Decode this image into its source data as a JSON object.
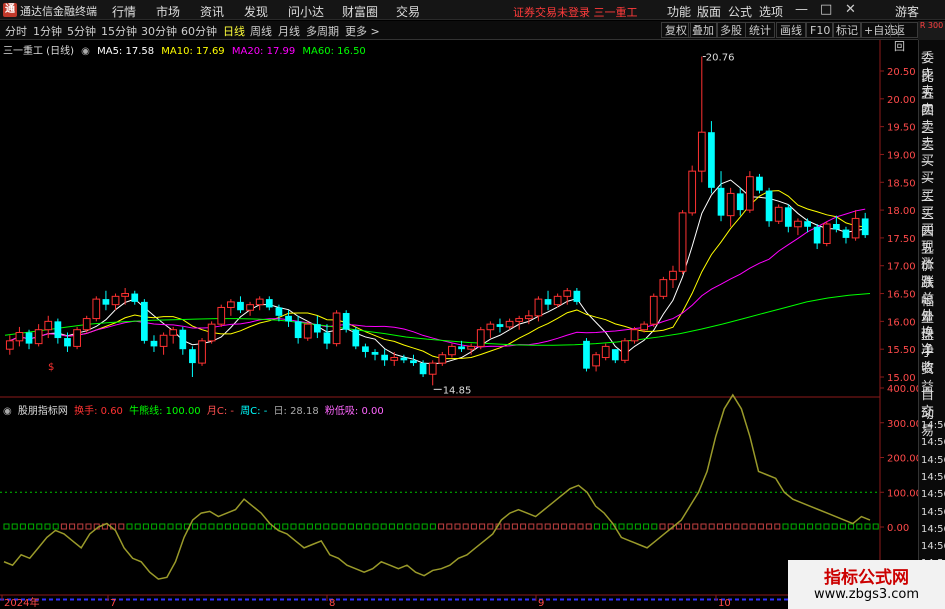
{
  "app": {
    "title": "通达信金融终端",
    "logo_char": "通",
    "menus": [
      "行情",
      "市场",
      "资讯",
      "发现",
      "问小达",
      "财富圈",
      "交易"
    ],
    "trade_warning": "证券交易未登录  三一重工",
    "right_menus": [
      "功能",
      "版面",
      "公式",
      "选项"
    ],
    "user": "游客",
    "window_controls": [
      "—",
      "□",
      "✕"
    ]
  },
  "toolbar": {
    "periods": [
      "分时",
      "1分钟",
      "5分钟",
      "15分钟",
      "30分钟",
      "60分钟",
      "日线",
      "周线",
      "月线",
      "多周期",
      "更多 >"
    ],
    "active_period": "日线",
    "buttons": [
      "复权",
      "叠加",
      "多股",
      "统计",
      "画线",
      "F10",
      "标记",
      "+自选",
      "返回"
    ],
    "sidebar_head": "R 300"
  },
  "price_header": {
    "stock": "三一重工 (日线)",
    "ma5": "MA5: 17.58",
    "ma10": "MA10: 17.69",
    "ma20": "MA20: 17.99",
    "ma60": "MA60: 16.50"
  },
  "price_axis": [
    "20.50",
    "20.00",
    "19.50",
    "19.00",
    "18.50",
    "18.00",
    "17.50",
    "17.00",
    "16.50",
    "16.00",
    "15.50",
    "15.00"
  ],
  "price_annotations": {
    "high": "20.76",
    "low": "14.85"
  },
  "indicator_header": {
    "name": "股朋指标网",
    "turnover": "换手: 0.60",
    "bull_bear": "牛熊线: 100.00",
    "month": "月C: -",
    "week": "周C: -",
    "day": "日: 28.18",
    "low_zone": "粉低吸: 0.00"
  },
  "indicator_axis": [
    "400.00",
    "300.00",
    "200.00",
    "100.00",
    "0.00"
  ],
  "date_axis": [
    "2024年",
    "7",
    "8",
    "9",
    "10"
  ],
  "right_panel": [
    "委比",
    "卖五",
    "卖四",
    "卖三",
    "卖二",
    "卖一",
    "买一",
    "买二",
    "买三",
    "买四",
    "买五",
    "现价",
    "涨跌",
    "涨幅",
    "总量",
    "外盘",
    "换手",
    "净资",
    "收益",
    "自动",
    "交易",
    "14:56",
    "14:56",
    "14:56",
    "14:56",
    "14:56",
    "14:56",
    "14:56",
    "14:56",
    "14:56"
  ],
  "watermark": {
    "title": "指标公式网",
    "url": "www.zbgs3.com"
  },
  "colors": {
    "up": "#ff3232",
    "down": "#00ffff",
    "ma5": "#ffffff",
    "ma10": "#ffff00",
    "ma20": "#ff00ff",
    "ma60": "#00ff00",
    "indicator": "#9a9a2a"
  },
  "chart_data": [
    {
      "type": "candlestick",
      "title": "三一重工 (日线)",
      "ylim": [
        14.7,
        20.8
      ],
      "x_months": [
        "2024年",
        "7",
        "8",
        "9",
        "10"
      ],
      "ohlc": [
        [
          15.5,
          15.75,
          15.4,
          15.65
        ],
        [
          15.65,
          15.9,
          15.55,
          15.8
        ],
        [
          15.8,
          15.85,
          15.5,
          15.6
        ],
        [
          15.6,
          15.95,
          15.55,
          15.85
        ],
        [
          15.85,
          16.1,
          15.7,
          16.0
        ],
        [
          16.0,
          16.05,
          15.6,
          15.7
        ],
        [
          15.7,
          15.8,
          15.45,
          15.55
        ],
        [
          15.55,
          15.9,
          15.5,
          15.85
        ],
        [
          15.85,
          16.1,
          15.8,
          16.05
        ],
        [
          16.05,
          16.45,
          16.0,
          16.4
        ],
        [
          16.4,
          16.55,
          16.2,
          16.3
        ],
        [
          16.3,
          16.5,
          16.2,
          16.45
        ],
        [
          16.45,
          16.6,
          16.3,
          16.5
        ],
        [
          16.5,
          16.55,
          16.3,
          16.35
        ],
        [
          16.35,
          16.4,
          15.6,
          15.65
        ],
        [
          15.65,
          15.75,
          15.45,
          15.55
        ],
        [
          15.55,
          15.8,
          15.4,
          15.75
        ],
        [
          15.75,
          15.9,
          15.6,
          15.85
        ],
        [
          15.85,
          15.9,
          15.4,
          15.5
        ],
        [
          15.5,
          15.55,
          15.0,
          15.25
        ],
        [
          15.25,
          15.7,
          15.2,
          15.65
        ],
        [
          15.65,
          16.0,
          15.6,
          15.95
        ],
        [
          15.95,
          16.3,
          15.9,
          16.25
        ],
        [
          16.25,
          16.4,
          16.1,
          16.35
        ],
        [
          16.35,
          16.45,
          16.15,
          16.2
        ],
        [
          16.2,
          16.35,
          16.1,
          16.3
        ],
        [
          16.3,
          16.45,
          16.2,
          16.4
        ],
        [
          16.4,
          16.45,
          16.2,
          16.25
        ],
        [
          16.25,
          16.3,
          16.0,
          16.1
        ],
        [
          16.1,
          16.2,
          15.9,
          16.0
        ],
        [
          16.0,
          16.1,
          15.6,
          15.7
        ],
        [
          15.7,
          16.0,
          15.65,
          15.95
        ],
        [
          15.95,
          16.1,
          15.7,
          15.8
        ],
        [
          15.8,
          15.95,
          15.5,
          15.6
        ],
        [
          15.6,
          16.2,
          15.55,
          16.15
        ],
        [
          16.15,
          16.2,
          15.8,
          15.85
        ],
        [
          15.85,
          15.9,
          15.5,
          15.55
        ],
        [
          15.55,
          15.6,
          15.35,
          15.45
        ],
        [
          15.45,
          15.5,
          15.3,
          15.4
        ],
        [
          15.4,
          15.5,
          15.2,
          15.3
        ],
        [
          15.3,
          15.45,
          15.2,
          15.35
        ],
        [
          15.35,
          15.4,
          15.25,
          15.3
        ],
        [
          15.3,
          15.4,
          15.2,
          15.25
        ],
        [
          15.25,
          15.3,
          15.0,
          15.05
        ],
        [
          15.05,
          15.3,
          14.85,
          15.25
        ],
        [
          15.25,
          15.45,
          15.2,
          15.4
        ],
        [
          15.4,
          15.6,
          15.35,
          15.55
        ],
        [
          15.55,
          15.65,
          15.45,
          15.5
        ],
        [
          15.5,
          15.6,
          15.4,
          15.55
        ],
        [
          15.55,
          15.9,
          15.5,
          15.85
        ],
        [
          15.85,
          16.0,
          15.7,
          15.95
        ],
        [
          15.95,
          16.05,
          15.8,
          15.9
        ],
        [
          15.9,
          16.05,
          15.85,
          16.0
        ],
        [
          16.0,
          16.1,
          15.85,
          16.05
        ],
        [
          16.05,
          16.2,
          15.95,
          16.1
        ],
        [
          16.1,
          16.45,
          16.0,
          16.4
        ],
        [
          16.4,
          16.55,
          16.2,
          16.3
        ],
        [
          16.3,
          16.5,
          16.25,
          16.45
        ],
        [
          16.45,
          16.6,
          16.3,
          16.55
        ],
        [
          16.55,
          16.6,
          16.3,
          16.35
        ],
        [
          15.65,
          15.7,
          15.1,
          15.15
        ],
        [
          15.2,
          15.45,
          15.1,
          15.4
        ],
        [
          15.35,
          15.6,
          15.3,
          15.55
        ],
        [
          15.5,
          15.5,
          15.25,
          15.3
        ],
        [
          15.3,
          15.7,
          15.25,
          15.65
        ],
        [
          15.65,
          15.9,
          15.6,
          15.85
        ],
        [
          15.85,
          16.0,
          15.8,
          15.95
        ],
        [
          15.95,
          16.5,
          15.9,
          16.45
        ],
        [
          16.45,
          16.8,
          16.4,
          16.75
        ],
        [
          16.75,
          17.0,
          16.6,
          16.9
        ],
        [
          16.9,
          18.0,
          16.85,
          17.95
        ],
        [
          17.95,
          18.8,
          17.9,
          18.7
        ],
        [
          18.7,
          20.76,
          18.5,
          19.4
        ],
        [
          19.4,
          19.6,
          18.3,
          18.4
        ],
        [
          18.4,
          18.7,
          17.8,
          17.9
        ],
        [
          17.9,
          18.4,
          17.7,
          18.3
        ],
        [
          18.3,
          18.4,
          17.9,
          18.0
        ],
        [
          18.0,
          18.7,
          17.95,
          18.6
        ],
        [
          18.6,
          18.65,
          18.3,
          18.35
        ],
        [
          18.35,
          18.4,
          17.7,
          17.8
        ],
        [
          17.8,
          18.1,
          17.75,
          18.05
        ],
        [
          18.05,
          18.1,
          17.6,
          17.7
        ],
        [
          17.7,
          17.85,
          17.55,
          17.8
        ],
        [
          17.8,
          17.85,
          17.6,
          17.7
        ],
        [
          17.7,
          17.75,
          17.3,
          17.4
        ],
        [
          17.4,
          17.8,
          17.35,
          17.75
        ],
        [
          17.75,
          17.9,
          17.6,
          17.65
        ],
        [
          17.65,
          17.7,
          17.4,
          17.5
        ],
        [
          17.5,
          18.0,
          17.45,
          17.85
        ],
        [
          17.85,
          17.95,
          17.5,
          17.55
        ]
      ],
      "ma60_line": [
        15.75,
        15.8,
        15.85,
        15.9,
        15.95,
        15.98,
        16.0,
        16.02,
        16.03,
        16.04,
        16.05,
        16.05,
        16.04,
        16.02,
        15.98,
        15.93,
        15.88,
        15.83,
        15.78,
        15.72,
        15.68,
        15.65,
        15.62,
        15.6,
        15.58,
        15.57,
        15.57,
        15.58,
        15.6,
        15.63,
        15.67,
        15.72,
        15.78,
        15.86,
        15.95,
        16.05,
        16.15,
        16.25,
        16.35,
        16.42,
        16.47,
        16.5
      ]
    },
    {
      "type": "line",
      "title": "股朋指标网",
      "ylim": [
        -200,
        420
      ],
      "series": [
        {
          "values": [
            -100,
            -110,
            -80,
            -90,
            -60,
            -30,
            -10,
            -20,
            -40,
            -60,
            -20,
            0,
            10,
            -10,
            -60,
            -90,
            -100,
            -130,
            -150,
            -145,
            -100,
            -30,
            20,
            40,
            45,
            30,
            40,
            50,
            80,
            60,
            40,
            10,
            -10,
            -20,
            -40,
            -60,
            -50,
            -40,
            -80,
            -90,
            -110,
            -120,
            -130,
            -120,
            -100,
            -110,
            -120,
            -110,
            -130,
            -140,
            -125,
            -120,
            -110,
            -90,
            -80,
            -60,
            -40,
            -20,
            20,
            40,
            50,
            40,
            30,
            50,
            70,
            90,
            110,
            120,
            100,
            60,
            40,
            10,
            -30,
            -40,
            -50,
            -60,
            -40,
            -20,
            0,
            20,
            60,
            100,
            160,
            260,
            340,
            380,
            340,
            260,
            160,
            150,
            140,
            100,
            80,
            70,
            60,
            50,
            40,
            30,
            20,
            10,
            30,
            20
          ]
        }
      ],
      "reference_lines": [
        100,
        0
      ]
    }
  ]
}
